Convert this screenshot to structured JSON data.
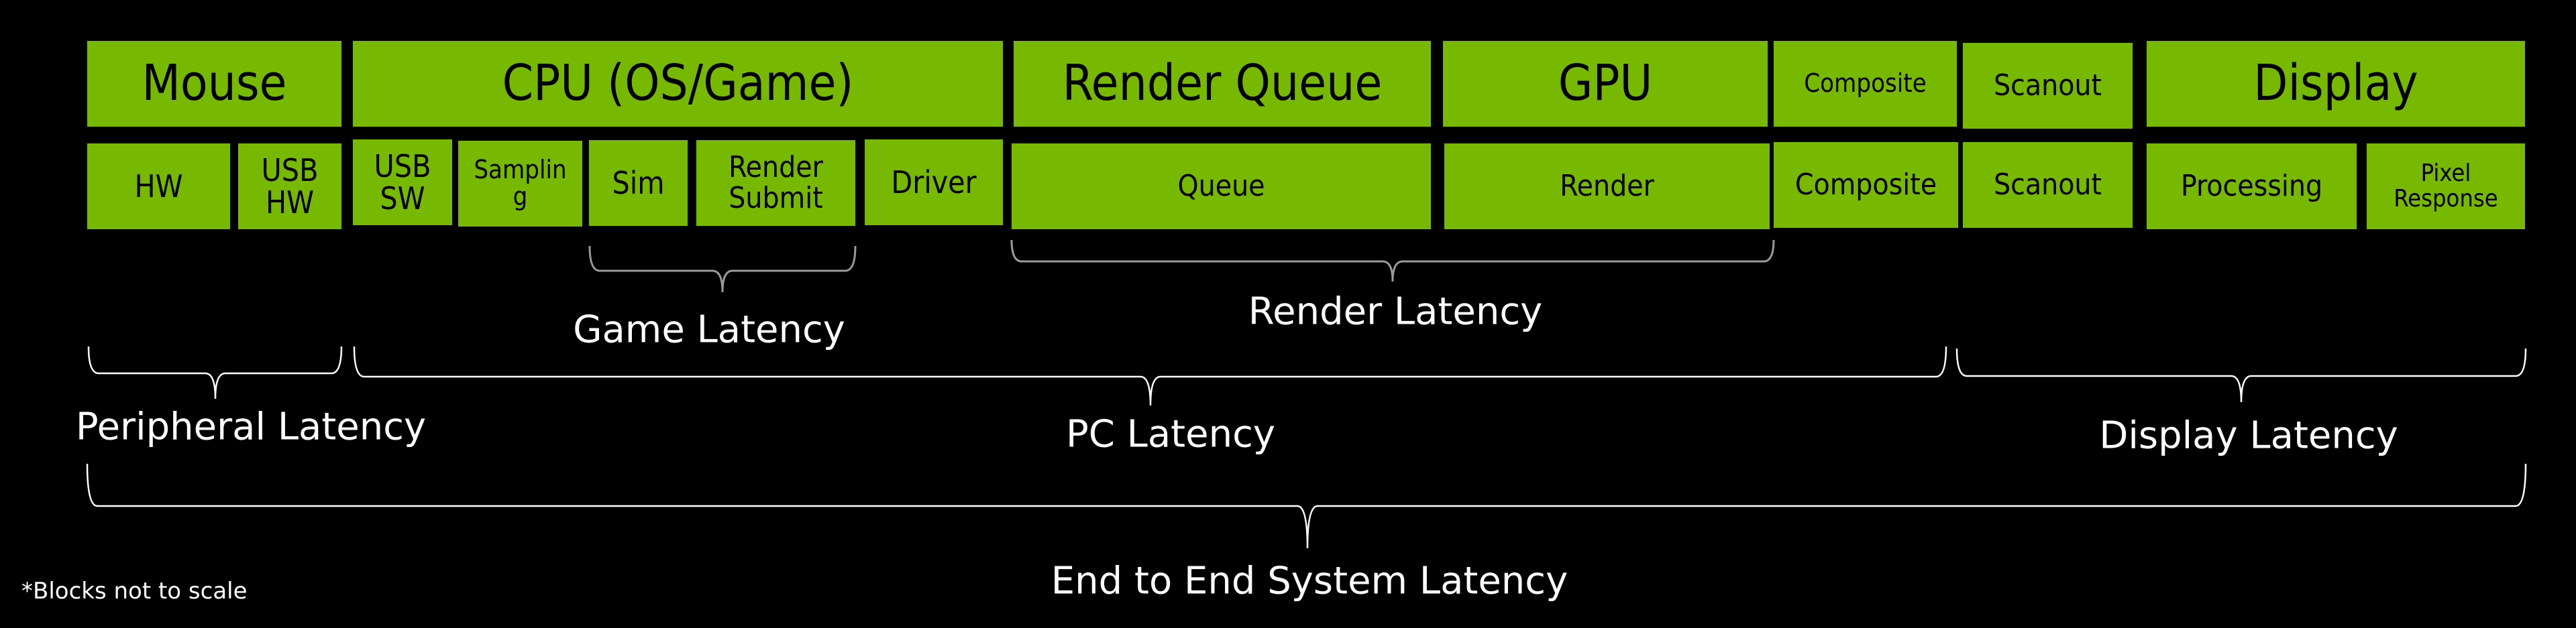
{
  "colors": {
    "block": "#76b900",
    "background": "#000000",
    "text_on_block": "#000000",
    "bracket": "#ffffff",
    "label": "#ffffff"
  },
  "top_row": [
    {
      "id": "mouse",
      "label": "Mouse"
    },
    {
      "id": "cpu",
      "label": "CPU (OS/Game)"
    },
    {
      "id": "render-queue",
      "label": "Render Queue"
    },
    {
      "id": "gpu",
      "label": "GPU"
    },
    {
      "id": "composite",
      "label": "Composite"
    },
    {
      "id": "scanout",
      "label": "Scanout"
    },
    {
      "id": "display",
      "label": "Display"
    }
  ],
  "bottom_row": [
    {
      "id": "hw",
      "label": "HW",
      "parent": "mouse"
    },
    {
      "id": "usb-hw",
      "label": "USB\nHW",
      "parent": "mouse"
    },
    {
      "id": "usb-sw",
      "label": "USB\nSW",
      "parent": "cpu"
    },
    {
      "id": "sampling",
      "label": "Samplin\ng",
      "parent": "cpu"
    },
    {
      "id": "sim",
      "label": "Sim",
      "parent": "cpu"
    },
    {
      "id": "render-submit",
      "label": "Render\nSubmit",
      "parent": "cpu"
    },
    {
      "id": "driver",
      "label": "Driver",
      "parent": "cpu"
    },
    {
      "id": "queue",
      "label": "Queue",
      "parent": "render-queue"
    },
    {
      "id": "render",
      "label": "Render",
      "parent": "gpu"
    },
    {
      "id": "composite-sub",
      "label": "Composite",
      "parent": "composite"
    },
    {
      "id": "scanout-sub",
      "label": "Scanout",
      "parent": "scanout"
    },
    {
      "id": "processing",
      "label": "Processing",
      "parent": "display"
    },
    {
      "id": "pixel-response",
      "label": "Pixel\nResponse",
      "parent": "display"
    }
  ],
  "latency_groups": [
    {
      "id": "game",
      "label": "Game Latency",
      "spans": [
        "sim",
        "render-submit"
      ]
    },
    {
      "id": "render",
      "label": "Render Latency",
      "spans": [
        "queue",
        "render"
      ]
    },
    {
      "id": "peripheral",
      "label": "Peripheral Latency",
      "spans": [
        "hw",
        "usb-hw"
      ]
    },
    {
      "id": "pc",
      "label": "PC Latency",
      "spans": [
        "usb-sw",
        "scanout-sub"
      ]
    },
    {
      "id": "display",
      "label": "Display Latency",
      "spans": [
        "processing",
        "pixel-response"
      ]
    },
    {
      "id": "end-to-end",
      "label": "End to End System Latency",
      "spans": [
        "hw",
        "pixel-response"
      ]
    }
  ],
  "footnote": "*Blocks not to scale"
}
